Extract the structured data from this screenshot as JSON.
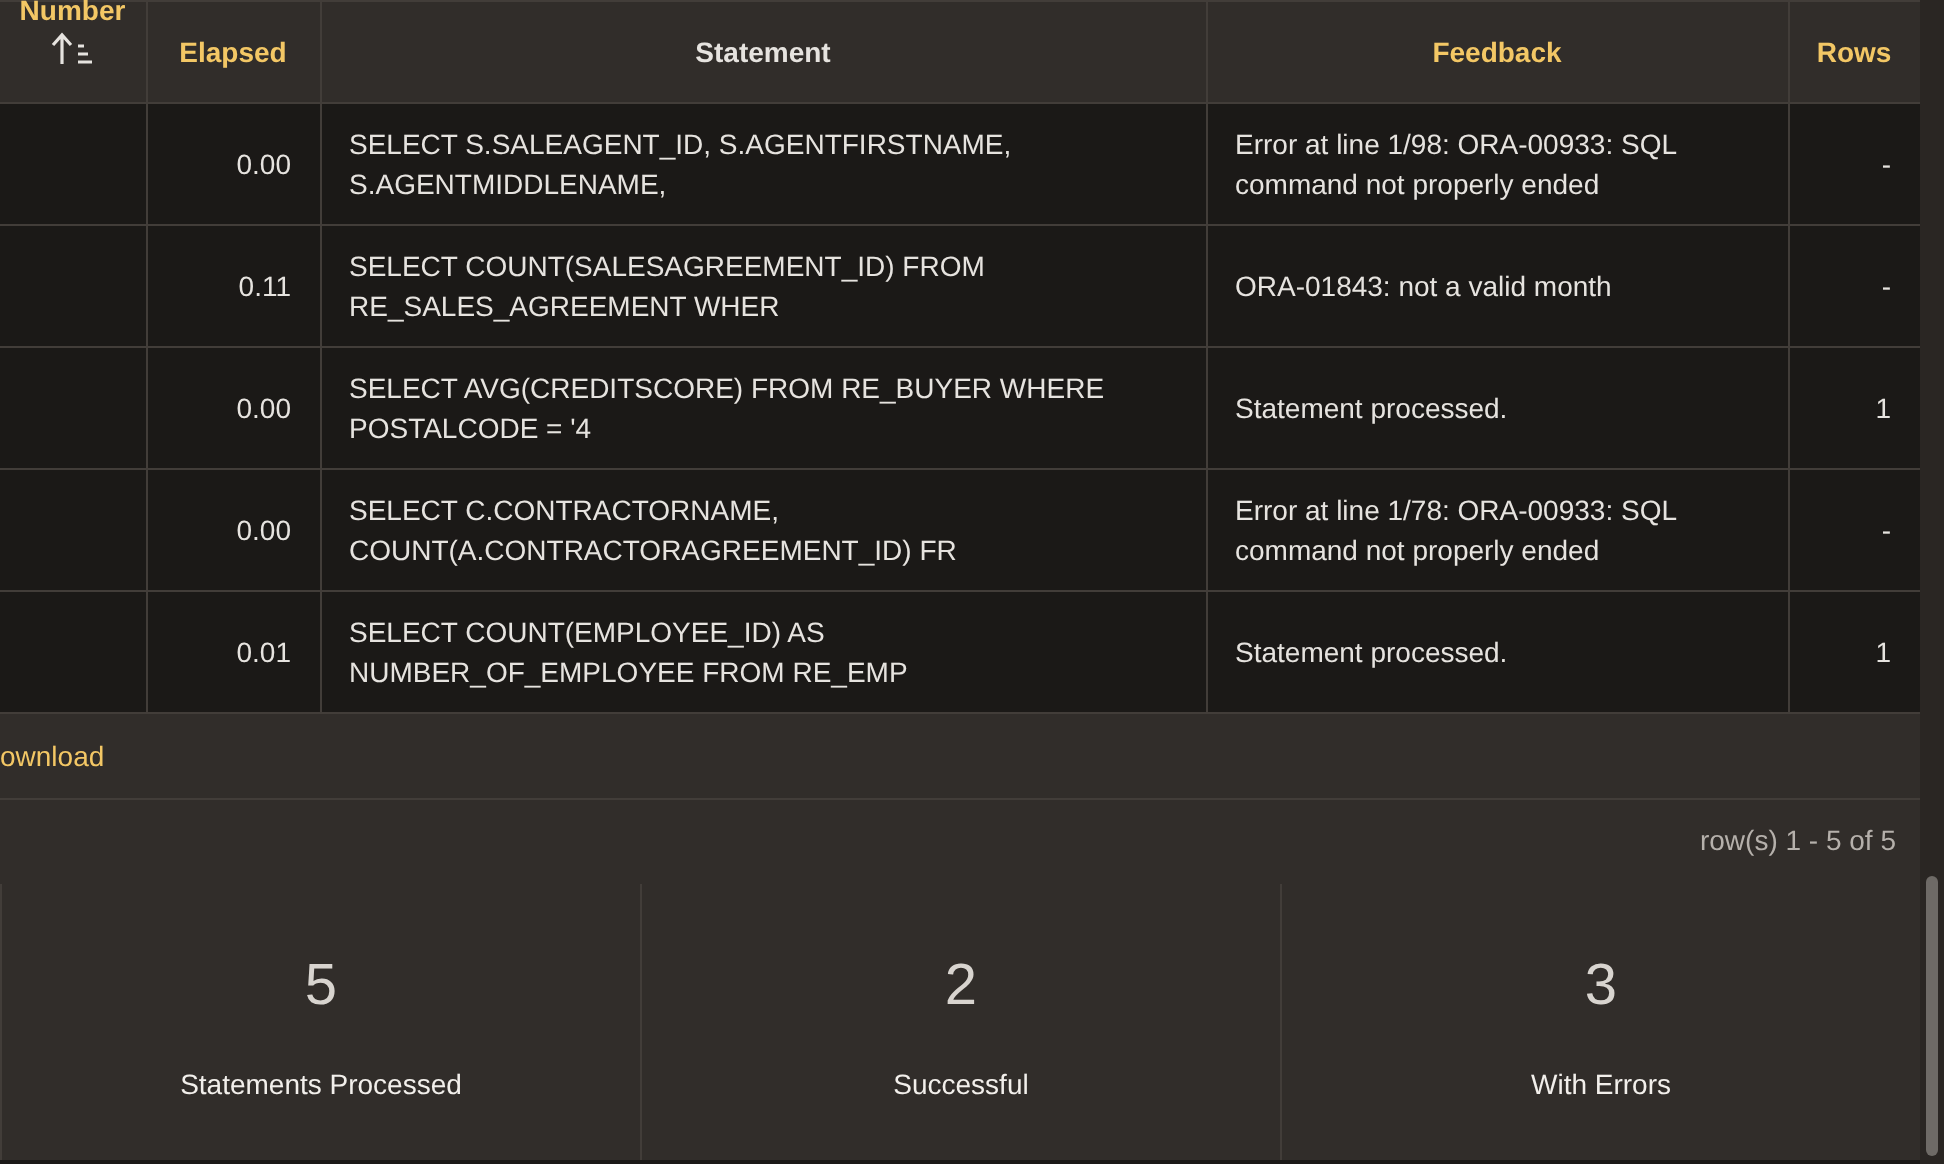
{
  "results_table": {
    "columns": [
      {
        "label": "Number",
        "sortable": true,
        "sorted": true
      },
      {
        "label": "Elapsed",
        "sortable": true,
        "sorted": false
      },
      {
        "label": "Statement",
        "sortable": false,
        "sorted": false
      },
      {
        "label": "Feedback",
        "sortable": true,
        "sorted": false
      },
      {
        "label": "Rows",
        "sortable": true,
        "sorted": false
      }
    ],
    "rows": [
      {
        "elapsed": "0.00",
        "statement": "SELECT S.SALEAGENT_ID, S.AGENTFIRSTNAME, S.AGENTMIDDLENAME,",
        "feedback": "Error at line 1/98: ORA-00933: SQL command not properly ended",
        "rows": "-"
      },
      {
        "elapsed": "0.11",
        "statement": "SELECT COUNT(SALESAGREEMENT_ID) FROM RE_SALES_AGREEMENT WHER",
        "feedback": "ORA-01843: not a valid month",
        "rows": "-"
      },
      {
        "elapsed": "0.00",
        "statement": "SELECT AVG(CREDITSCORE) FROM RE_BUYER WHERE POSTALCODE = '4",
        "feedback": "Statement processed.",
        "rows": "1"
      },
      {
        "elapsed": "0.00",
        "statement": "SELECT C.CONTRACTORNAME, COUNT(A.CONTRACTORAGREEMENT_ID) FR",
        "feedback": "Error at line 1/78: ORA-00933: SQL command not properly ended",
        "rows": "-"
      },
      {
        "elapsed": "0.01",
        "statement": "SELECT COUNT(EMPLOYEE_ID) AS NUMBER_OF_EMPLOYEE FROM RE_EMP",
        "feedback": "Statement processed.",
        "rows": "1"
      }
    ],
    "download_link": "ownload",
    "pagination": "row(s) 1 - 5 of 5"
  },
  "summary": [
    {
      "value": "5",
      "label": "Statements Processed"
    },
    {
      "value": "2",
      "label": "Successful"
    },
    {
      "value": "3",
      "label": "With Errors"
    }
  ]
}
